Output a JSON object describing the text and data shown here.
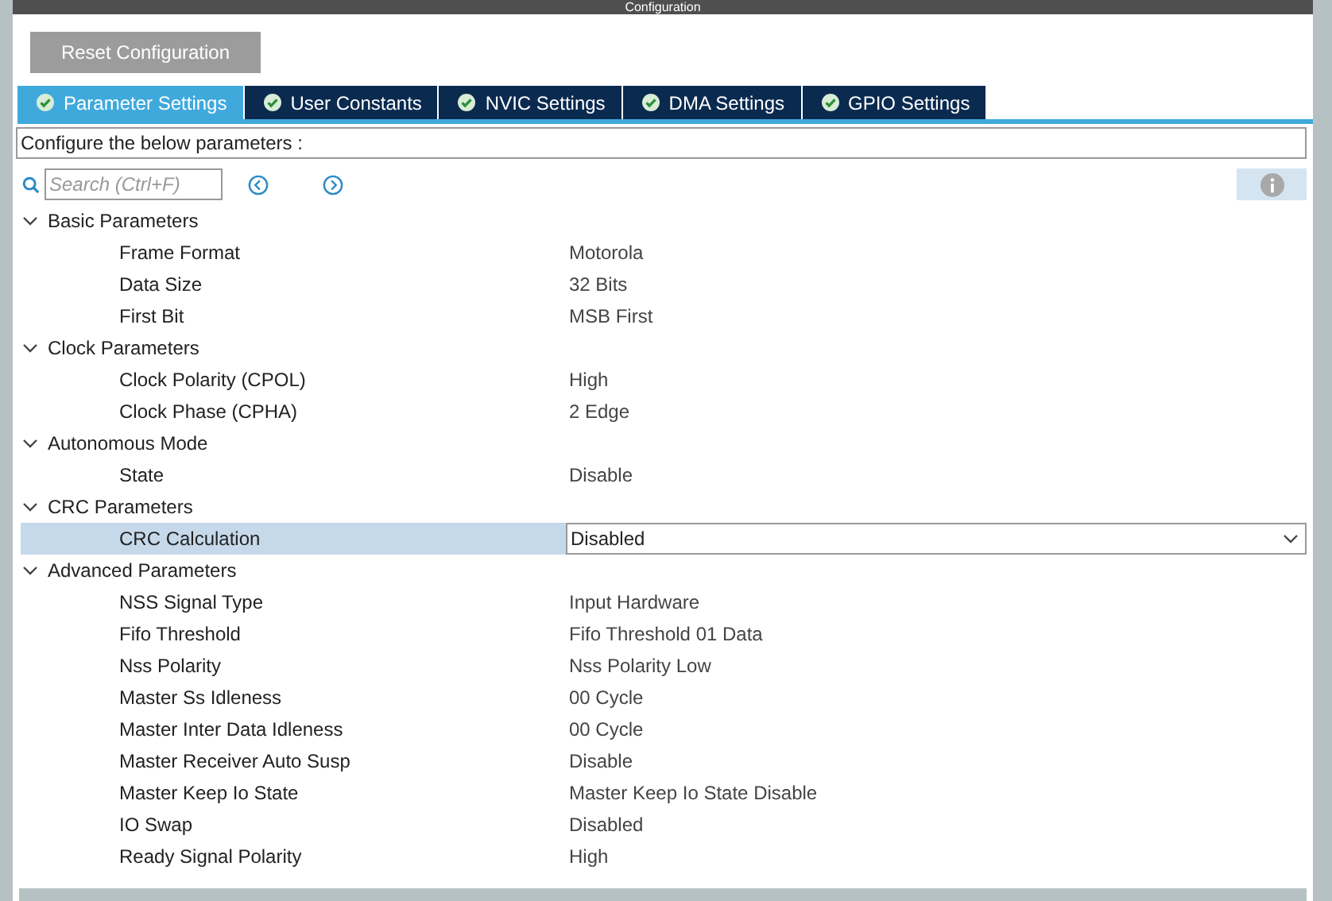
{
  "window": {
    "title": "Configuration"
  },
  "reset_button": "Reset Configuration",
  "tabs": [
    {
      "label": "Parameter Settings",
      "selected": true
    },
    {
      "label": "User Constants",
      "selected": false
    },
    {
      "label": "NVIC Settings",
      "selected": false
    },
    {
      "label": "DMA Settings",
      "selected": false
    },
    {
      "label": "GPIO Settings",
      "selected": false
    }
  ],
  "hint": "Configure the below parameters :",
  "search": {
    "placeholder": "Search (Ctrl+F)"
  },
  "groups": [
    {
      "label": "Basic Parameters",
      "expanded": true,
      "children": [
        {
          "name": "Frame Format",
          "value": "Motorola",
          "selected": false
        },
        {
          "name": "Data Size",
          "value": "32 Bits",
          "selected": false
        },
        {
          "name": "First Bit",
          "value": "MSB First",
          "selected": false
        }
      ]
    },
    {
      "label": "Clock Parameters",
      "expanded": true,
      "children": [
        {
          "name": "Clock Polarity (CPOL)",
          "value": "High",
          "selected": false
        },
        {
          "name": "Clock Phase (CPHA)",
          "value": "2 Edge",
          "selected": false
        }
      ]
    },
    {
      "label": "Autonomous Mode",
      "expanded": true,
      "children": [
        {
          "name": "State",
          "value": "Disable",
          "selected": false
        }
      ]
    },
    {
      "label": "CRC Parameters",
      "expanded": true,
      "children": [
        {
          "name": "CRC Calculation",
          "value": "Disabled",
          "selected": true
        }
      ]
    },
    {
      "label": "Advanced Parameters",
      "expanded": true,
      "children": [
        {
          "name": "NSS Signal Type",
          "value": "Input Hardware",
          "selected": false
        },
        {
          "name": "Fifo Threshold",
          "value": "Fifo Threshold 01 Data",
          "selected": false
        },
        {
          "name": "Nss Polarity",
          "value": "Nss Polarity Low",
          "selected": false
        },
        {
          "name": "Master Ss Idleness",
          "value": "00 Cycle",
          "selected": false
        },
        {
          "name": "Master Inter Data Idleness",
          "value": "00 Cycle",
          "selected": false
        },
        {
          "name": "Master Receiver Auto Susp",
          "value": "Disable",
          "selected": false
        },
        {
          "name": "Master Keep Io State",
          "value": "Master Keep Io State Disable",
          "selected": false
        },
        {
          "name": "IO Swap",
          "value": "Disabled",
          "selected": false
        },
        {
          "name": "Ready Signal Polarity",
          "value": "High",
          "selected": false
        }
      ]
    }
  ]
}
